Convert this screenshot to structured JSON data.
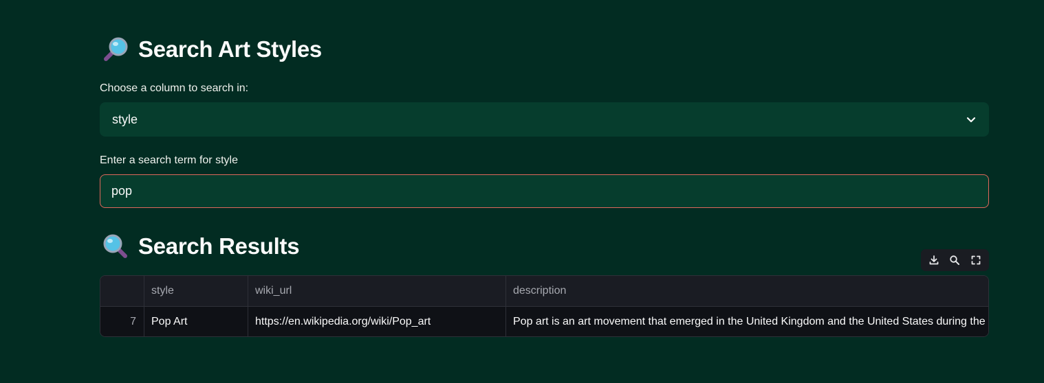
{
  "search_section": {
    "title": "Search Art Styles",
    "title_icon": "magnifying-glass-right-icon",
    "column_label": "Choose a column to search in:",
    "column_selected": "style",
    "term_label": "Enter a search term for style",
    "term_value": "pop"
  },
  "results_section": {
    "title": "Search Results",
    "title_icon": "magnifying-glass-left-icon",
    "toolbar": [
      "download-icon",
      "search-icon",
      "fullscreen-icon"
    ],
    "table": {
      "columns": [
        "",
        "style",
        "wiki_url",
        "description"
      ],
      "rows": [
        {
          "index": "7",
          "style": "Pop Art",
          "wiki_url": "https://en.wikipedia.org/wiki/Pop_art",
          "description": "Pop art is an art movement that emerged in the United Kingdom and the United States during the"
        }
      ]
    }
  },
  "colors": {
    "background": "#022c22",
    "field_background": "#063d2d",
    "input_focus_border": "#e0685b",
    "table_header": "#1a1c23",
    "table_body": "#0f1116"
  }
}
